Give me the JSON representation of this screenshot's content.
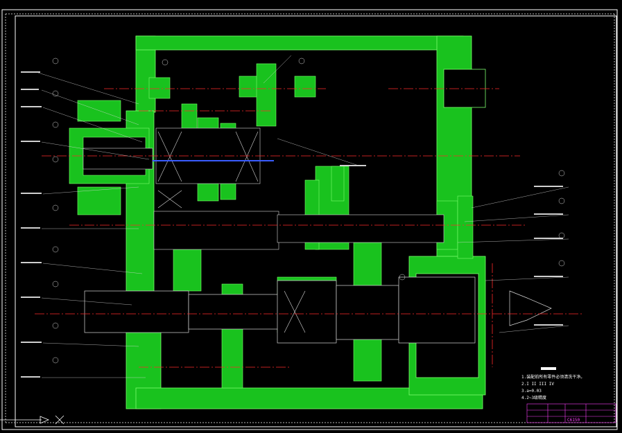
{
  "colors": {
    "background": "#000000",
    "part_fill": "#19c21e",
    "part_edge": "#7dff6e",
    "centerline": "#ff2a2a",
    "leader": "#d8d8d8",
    "frame": "#ffffff",
    "title_block": "#ff40ff",
    "blue": "#3a5cff"
  },
  "notes": {
    "line1": "1.装配前所有零件必须清洗干净。",
    "line2": "2.I   II   III   IV",
    "line3": "3.a=0.03",
    "line4": "4.2~3级精度"
  },
  "title_block": {
    "name": "C6150"
  },
  "icons": {
    "cursor": "crosshair-cursor-icon",
    "ucs": "ucs-arrow-icon"
  }
}
